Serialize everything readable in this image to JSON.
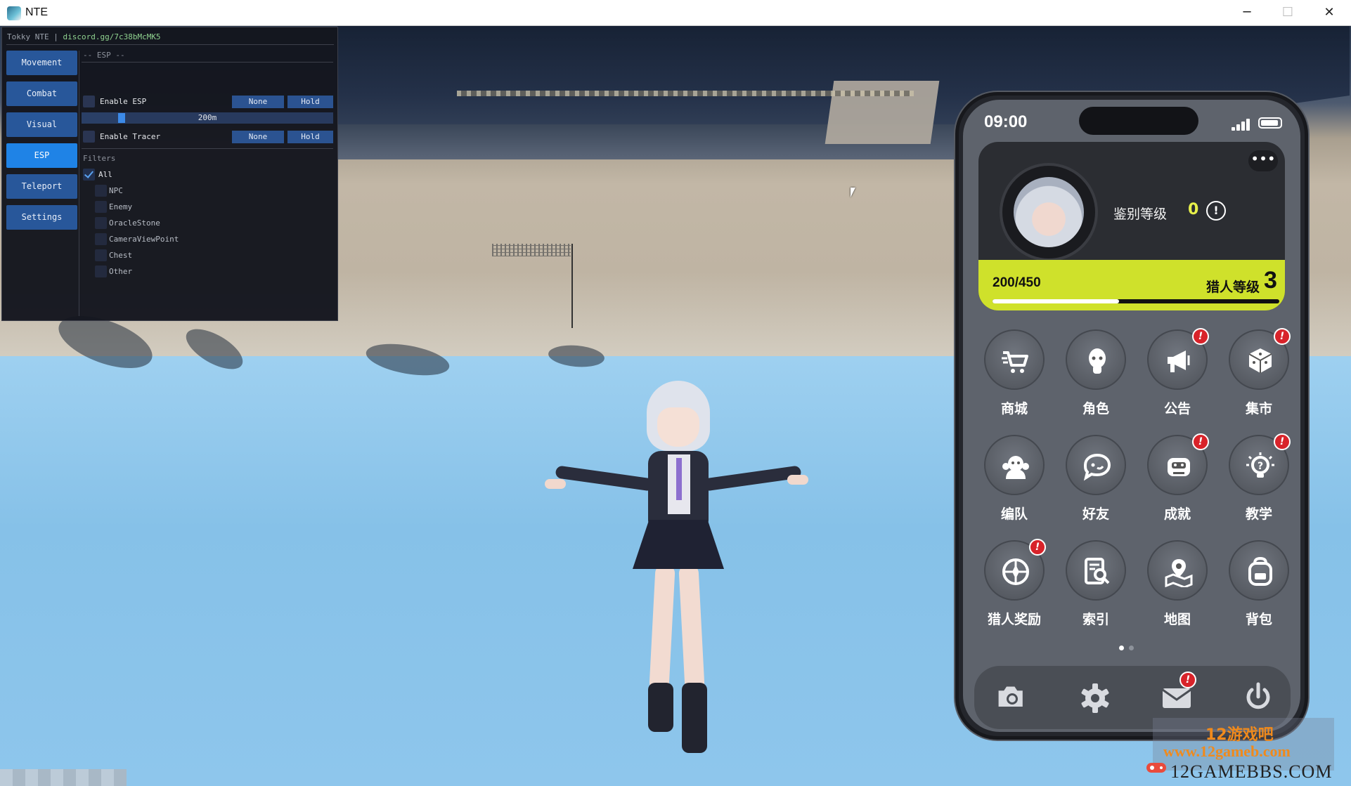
{
  "window": {
    "title": "NTE",
    "min_symbol": "─",
    "max_symbol": "☐",
    "close_symbol": "✕"
  },
  "menu": {
    "brand": "Tokky NTE",
    "separator": " | ",
    "link": "discord.gg/7c38bMcMK5",
    "nav": [
      "Movement",
      "Combat",
      "Visual",
      "ESP",
      "Teleport",
      "Settings"
    ],
    "active_nav": "ESP",
    "section_title": "-- ESP --",
    "enable_esp": {
      "label": "Enable ESP",
      "checked": false,
      "mode": "None",
      "key": "Hold"
    },
    "distance": {
      "label": "200m",
      "fraction": 0.16
    },
    "enable_tracer": {
      "label": "Enable Tracer",
      "checked": false,
      "mode": "None",
      "key": "Hold"
    },
    "filters_title": "Filters",
    "filter_all": {
      "label": "All",
      "checked": true
    },
    "filters": [
      "NPC",
      "Enemy",
      "OracleStone",
      "CameraViewPoint",
      "Chest",
      "Other"
    ]
  },
  "phone": {
    "time": "09:00",
    "more": "•••",
    "rank_label": "鉴别等级",
    "rank_value": "0",
    "rank_info": "!",
    "xp": "200/450",
    "xp_fraction": 0.44,
    "hunter_label": "猎人等级",
    "hunter_value": "3",
    "apps": [
      {
        "label": "商城",
        "icon": "cart-icon",
        "badge": ""
      },
      {
        "label": "角色",
        "icon": "character-icon",
        "badge": ""
      },
      {
        "label": "公告",
        "icon": "megaphone-icon",
        "badge": "!"
      },
      {
        "label": "集市",
        "icon": "dice-icon",
        "badge": "!"
      },
      {
        "label": "编队",
        "icon": "team-icon",
        "badge": ""
      },
      {
        "label": "好友",
        "icon": "chat-bubble-icon",
        "badge": ""
      },
      {
        "label": "成就",
        "icon": "robot-icon",
        "badge": "!"
      },
      {
        "label": "教学",
        "icon": "lightbulb-icon",
        "badge": "!"
      },
      {
        "label": "猎人奖励",
        "icon": "compass-icon",
        "badge": "!"
      },
      {
        "label": "索引",
        "icon": "search-doc-icon",
        "badge": ""
      },
      {
        "label": "地图",
        "icon": "map-pin-icon",
        "badge": ""
      },
      {
        "label": "背包",
        "icon": "backpack-icon",
        "badge": ""
      }
    ],
    "page_count": 2,
    "current_page": 1,
    "dock": [
      {
        "icon": "camera-icon",
        "badge": ""
      },
      {
        "icon": "gear-icon",
        "badge": ""
      },
      {
        "icon": "mail-icon",
        "badge": "!"
      },
      {
        "icon": "power-icon",
        "badge": ""
      }
    ],
    "colors": {
      "accent": "#cfe12b",
      "badge": "#d8232a"
    }
  },
  "watermark": {
    "cn": "12游戏吧",
    "url": "www.12gameb.com",
    "bbs": "12GAMEBBS.COM"
  }
}
